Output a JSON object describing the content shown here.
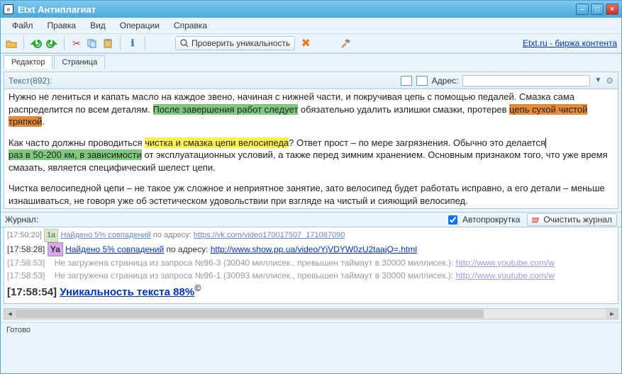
{
  "window": {
    "title": "Etxt Антиплагиат"
  },
  "menu": {
    "items": [
      "Файл",
      "Правка",
      "Вид",
      "Операции",
      "Справка"
    ]
  },
  "toolbar": {
    "check_label": "Проверить уникальность",
    "right_link": "Etxt.ru - биржа контента"
  },
  "tabs": {
    "items": [
      "Редактор",
      "Страница"
    ],
    "active": 0
  },
  "editor": {
    "header_label": "Текст(892):",
    "address_label": "Адрес:",
    "address_value": "",
    "paragraphs": {
      "p1_a": "Нужно не лениться и капать масло на каждое звено, начиная с нижней части, и покручивая цепь с помощью педалей. Смазка сама распределится по всем деталям. ",
      "p1_hl1": "После завершения работ следует",
      "p1_b": " обязательно удалить излишки смазки, протерев ",
      "p1_hl2": "цепь сухой чистой тряпкой",
      "p1_c": ".",
      "p2_a": "Как часто должны проводиться ",
      "p2_hl1": "чистка и смазка цепи велосипеда",
      "p2_b": "? Ответ прост – по мере загрязнения. Обычно это делается",
      "p2_hl2": "раз в 50-200 км, в зависимости",
      "p2_c": " от эксплуатационных условий, а также перед зимним хранением. Основным признаком того, что уже время смазать, является специфический шелест цепи.",
      "p3": "Чистка велосипедной цепи – не такое уж сложное и неприятное занятие, зато велосипед будет работать исправно, а его детали – меньше изнашиваться, не говоря уже об эстетическом удовольствии при взгляде на чистый и сияющий велосипед."
    }
  },
  "journal": {
    "label": "Журнал:",
    "autoscroll_label": "Автопрокрутка",
    "autoscroll_checked": true,
    "clear_label": "Очистить журнал",
    "rows": {
      "r0_ts": "[17:50:20]",
      "r0_tag": "1a",
      "r0_msg": "Найдено 5% совпадений",
      "r0_sep": " по адресу: ",
      "r0_url": "https://vk.com/video170017507_171087090",
      "r1_ts": "[17:58:28]",
      "r1_tag": "Ya",
      "r1_msg": "Найдено 5% совпадений",
      "r1_sep": " по адресу: ",
      "r1_url": "http://www.show.pp.ua/video/YjVDYW0zU2taajQ=.html",
      "r2_ts": "[17:58:53]",
      "r2_msg": "Не загружена страница из запроса №96-3 (30040 миллисек., превышен таймаут в 30000 миллисек.): ",
      "r2_url": "http://www.youtube.com/w",
      "r3_ts": "[17:58:53]",
      "r3_msg": "Не загружена страница из запроса №96-1 (30093 миллисек., превышен таймаут в 30000 миллисек.): ",
      "r3_url": "http://www.youtube.com/w",
      "r4_ts": "[17:58:54]",
      "r4_msg_a": "Уникальность текста 88%",
      "r4_msg_b": "©"
    }
  },
  "status": {
    "text": "Готово"
  }
}
